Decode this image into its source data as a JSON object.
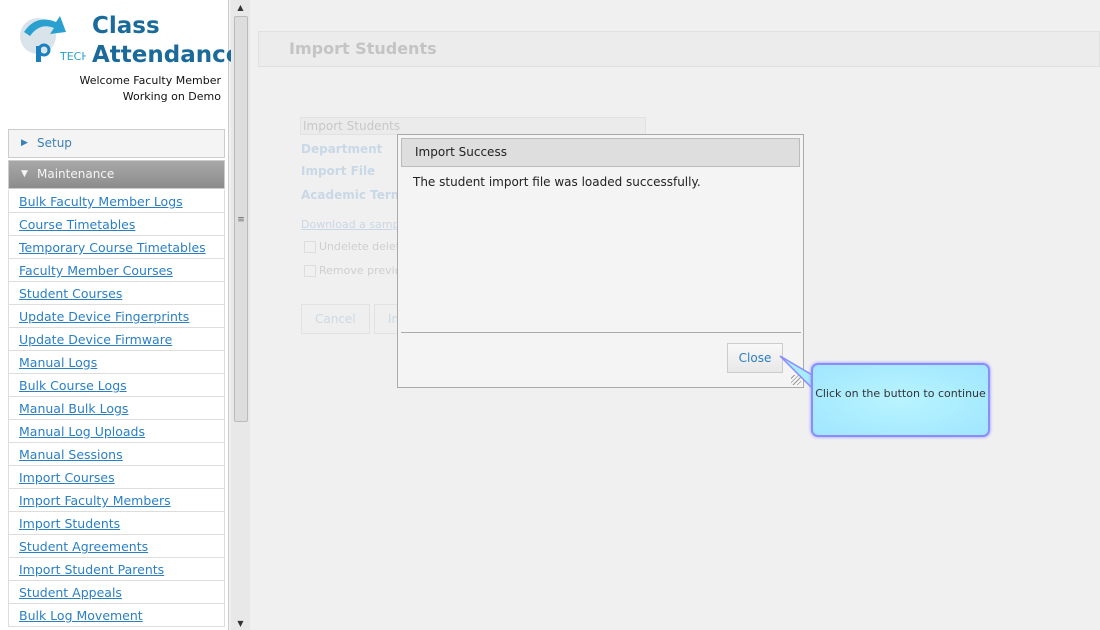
{
  "app": {
    "title_line1": "Class",
    "title_line2": "Attendance",
    "logo_text": "TECH",
    "welcome": "Welcome Faculty Member",
    "working_on": "Working on Demo"
  },
  "sidebar": {
    "setup": "Setup",
    "maintenance": "Maintenance",
    "items": [
      "Bulk Faculty Member Logs",
      "Course Timetables",
      "Temporary Course Timetables",
      "Faculty Member Courses",
      "Student Courses",
      "Update Device Fingerprints",
      "Update Device Firmware",
      "Manual Logs",
      "Bulk Course Logs",
      "Manual Bulk Logs",
      "Manual Log Uploads",
      "Manual Sessions",
      "Import Courses",
      "Import Faculty Members",
      "Import Students",
      "Student Agreements",
      "Import Student Parents",
      "Student Appeals",
      "Bulk Log Movement"
    ]
  },
  "page": {
    "title": "Import Students",
    "section": "Import Students",
    "labels": {
      "department": "Department",
      "import_file": "Import File",
      "academic_terms": "Academic Terms"
    },
    "download_link": "Download a sample",
    "checkbox1": "Undelete delete",
    "checkbox2": "Remove previou",
    "cancel": "Cancel",
    "import": "Import"
  },
  "dialog": {
    "title": "Import Success",
    "message": "The student import file was loaded successfully.",
    "close": "Close"
  },
  "callout": {
    "text": "Click on the button to continue"
  }
}
